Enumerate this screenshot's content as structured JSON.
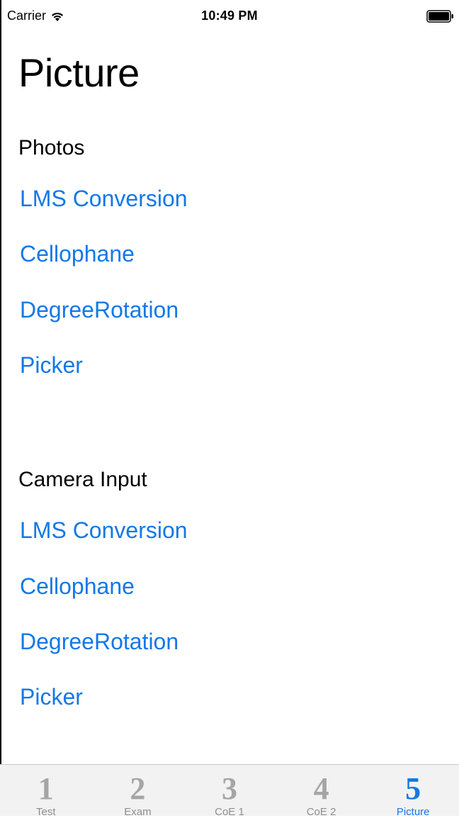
{
  "status_bar": {
    "carrier": "Carrier",
    "time": "10:49 PM",
    "wifi_icon": "wifi-icon",
    "battery_icon": "battery-icon"
  },
  "page": {
    "title": "Picture"
  },
  "sections": [
    {
      "header": "Photos",
      "items": [
        "LMS Conversion",
        "Cellophane",
        "DegreeRotation",
        "Picker"
      ]
    },
    {
      "header": "Camera Input",
      "items": [
        "LMS Conversion",
        "Cellophane",
        "DegreeRotation",
        "Picker"
      ]
    }
  ],
  "tab_bar": {
    "tabs": [
      {
        "number": "1",
        "label": "Test",
        "active": false
      },
      {
        "number": "2",
        "label": "Exam",
        "active": false
      },
      {
        "number": "3",
        "label": "CoE 1",
        "active": false
      },
      {
        "number": "4",
        "label": "CoE 2",
        "active": false
      },
      {
        "number": "5",
        "label": "Picture",
        "active": true
      }
    ]
  },
  "colors": {
    "accent": "#1478e6",
    "tab_inactive": "#a5a5a5",
    "tab_bar_bg": "#f2f2f2"
  }
}
